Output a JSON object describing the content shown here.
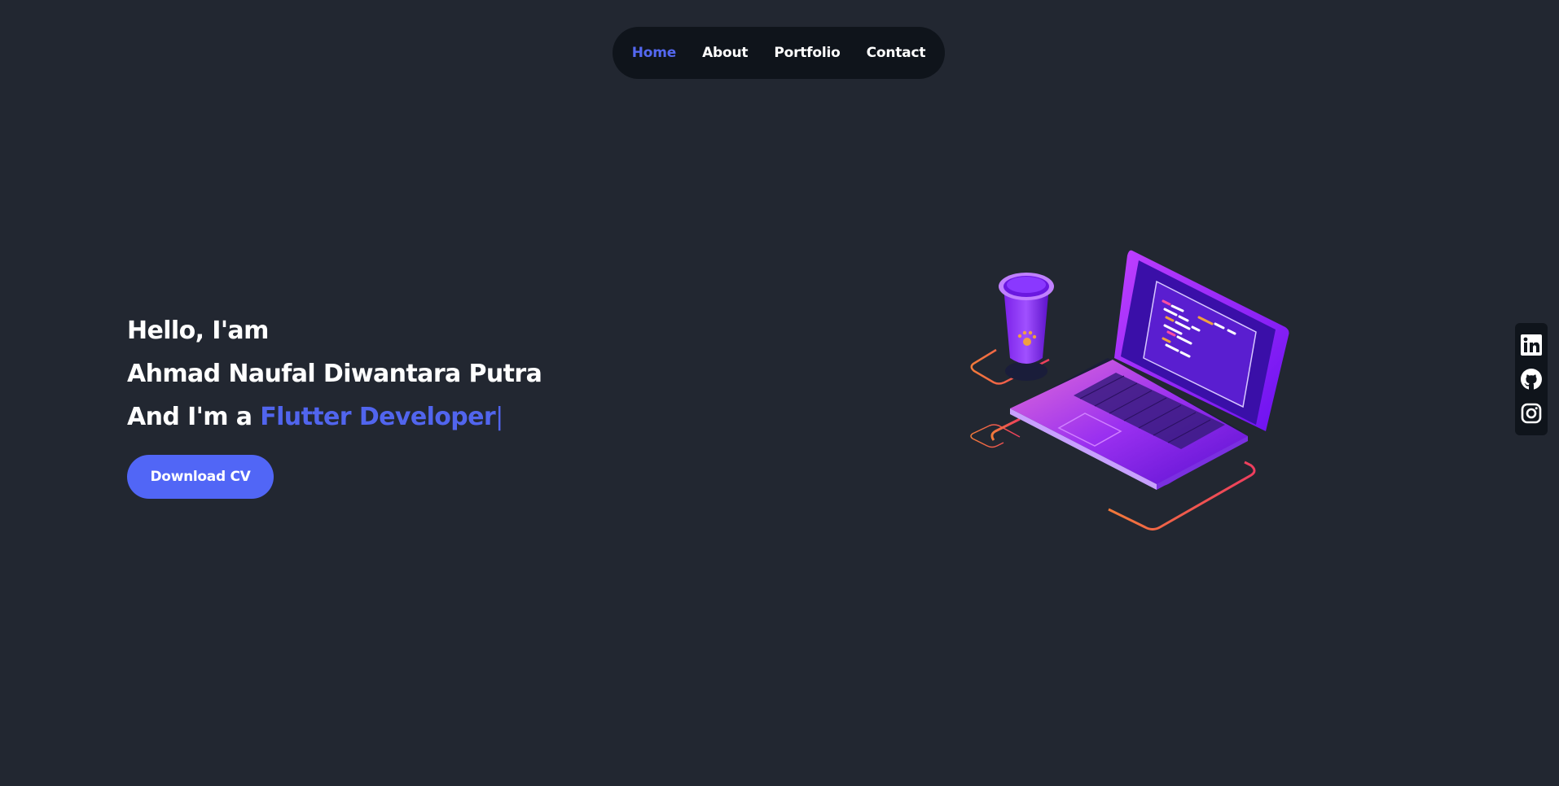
{
  "nav": {
    "items": [
      {
        "label": "Home",
        "active": true
      },
      {
        "label": "About",
        "active": false
      },
      {
        "label": "Portfolio",
        "active": false
      },
      {
        "label": "Contact",
        "active": false
      }
    ]
  },
  "hero": {
    "greeting": "Hello, I'am",
    "name": "Ahmad Naufal Diwantara Putra",
    "role_prefix": "And I'm a ",
    "role": "Flutter Developer",
    "cursor": "|",
    "cta_label": "Download CV"
  },
  "social": {
    "icons": [
      "linkedin-icon",
      "github-icon",
      "instagram-icon"
    ]
  },
  "colors": {
    "background": "#222731",
    "nav_bg": "#0f141b",
    "accent": "#5166f6"
  }
}
